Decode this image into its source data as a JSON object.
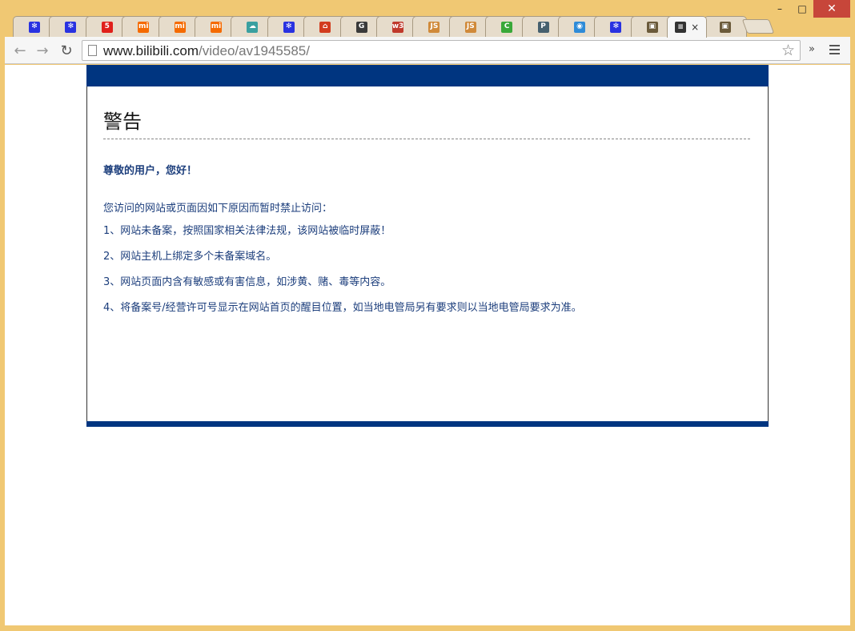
{
  "window": {
    "minimize_label": "–",
    "maximize_label": "□",
    "close_label": "✕"
  },
  "tabs": [
    {
      "icon": "baidu-paw-icon",
      "glyph": "✻",
      "color": "#2932e1"
    },
    {
      "icon": "baidu-paw-icon",
      "glyph": "✻",
      "color": "#2932e1"
    },
    {
      "icon": "number-5-icon",
      "glyph": "5",
      "color": "#e0201b"
    },
    {
      "icon": "xiaomi-mi-icon",
      "glyph": "mi",
      "color": "#f56a00"
    },
    {
      "icon": "xiaomi-mi-icon",
      "glyph": "mi",
      "color": "#f56a00"
    },
    {
      "icon": "xiaomi-mi-icon",
      "glyph": "mi",
      "color": "#f56a00"
    },
    {
      "icon": "cloud-icon",
      "glyph": "☁",
      "color": "#3aa0a0"
    },
    {
      "icon": "baidu-paw-icon",
      "glyph": "✻",
      "color": "#2932e1"
    },
    {
      "icon": "house-icon",
      "glyph": "⌂",
      "color": "#d23c1e"
    },
    {
      "icon": "g-letter-icon",
      "glyph": "G",
      "color": "#3a3a3a"
    },
    {
      "icon": "w3-icon",
      "glyph": "w3",
      "color": "#c0392b"
    },
    {
      "icon": "js-icon",
      "glyph": "JS",
      "color": "#d08a3a"
    },
    {
      "icon": "js-icon",
      "glyph": "JS",
      "color": "#d08a3a"
    },
    {
      "icon": "c-letter-icon",
      "glyph": "C",
      "color": "#39a839"
    },
    {
      "icon": "p-letter-icon",
      "glyph": "P",
      "color": "#46606e"
    },
    {
      "icon": "wifi-icon",
      "glyph": "◉",
      "color": "#2e8bd8"
    },
    {
      "icon": "baidu-paw-icon",
      "glyph": "✻",
      "color": "#2932e1"
    },
    {
      "icon": "bilibili-tv-icon",
      "glyph": "▣",
      "color": "#6b5a3a"
    },
    {
      "icon": "text-lines-icon",
      "glyph": "≡",
      "color": "#333333",
      "active": true,
      "close": "×"
    },
    {
      "icon": "bilibili-tv-icon",
      "glyph": "▣",
      "color": "#6b5a3a"
    }
  ],
  "toolbar": {
    "back": "←",
    "forward": "→",
    "reload": "↻",
    "url_host": "www.bilibili.com",
    "url_path": "/video/av1945585/",
    "star": "☆",
    "extensions": "»"
  },
  "page": {
    "title": "警告",
    "greeting": "尊敬的用户，您好！",
    "intro": "您访问的网站或页面因如下原因而暂时禁止访问：",
    "reasons": [
      "1、网站未备案，按照国家相关法律法规，该网站被临时屏蔽！",
      "2、网站主机上绑定多个未备案域名。",
      "3、网站页面内含有敏感或有害信息，如涉黄、赌、毒等内容。",
      "4、将备案号/经营许可号显示在网站首页的醒目位置，如当地电管局另有要求则以当地电管局要求为准。"
    ],
    "colors": {
      "accent_bar": "#003580",
      "text": "#1c3e7c"
    }
  }
}
